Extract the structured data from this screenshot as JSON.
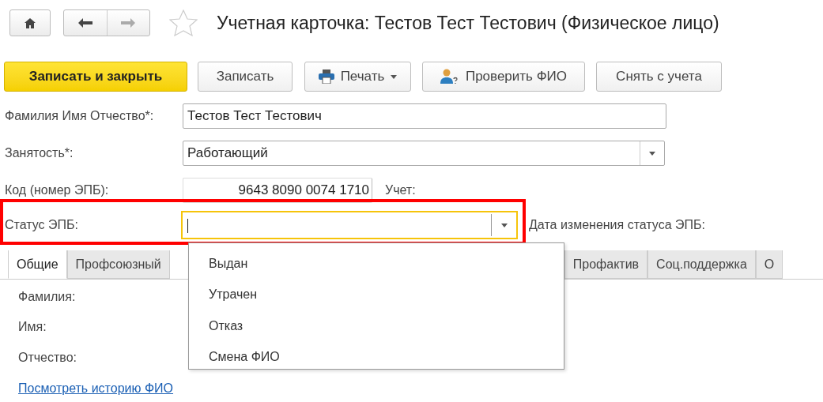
{
  "window": {
    "title": "Учетная карточка: Тестов Тест Тестович (Физическое лицо)",
    "favorite": false
  },
  "toolbar": [
    {
      "label": "Записать и закрыть",
      "kind": "primary"
    },
    {
      "label": "Записать",
      "kind": "plain"
    },
    {
      "label": "Печать",
      "kind": "menu"
    },
    {
      "label": "Проверить ФИО",
      "kind": "person"
    },
    {
      "label": "Снять с учета",
      "kind": "plain"
    }
  ],
  "fields": [
    {
      "label": "Фамилия Имя Отчество*:",
      "value": "Тестов Тест Тестович",
      "kind": "text"
    },
    {
      "label": "Занятость*:",
      "value": "Работающий",
      "kind": "select"
    },
    {
      "label": "Код (номер ЭПБ):",
      "value": "9643 8090 0074 1710",
      "kind": "code",
      "side_label": "Учет:"
    },
    {
      "label": "Статус ЭПБ:",
      "kind": "focused",
      "side_label": "Дата изменения статуса ЭПБ:",
      "highlighted": true
    }
  ],
  "tabs_left": [
    {
      "label": "Общие",
      "selected": true
    },
    {
      "label": "Профсоюзный",
      "selected": false
    }
  ],
  "tabs_right": [
    {
      "label": "Профактив",
      "selected": false
    },
    {
      "label": "Соц.поддержка",
      "selected": false
    },
    {
      "label": "О",
      "selected": false
    }
  ],
  "tab_content": {
    "labels": [
      "Фамилия:",
      "Имя:",
      "Отчество:"
    ],
    "link": "Посмотреть историю ФИО"
  },
  "dropdown": {
    "options": [
      "Выдан",
      "Утрачен",
      "Отказ",
      "Смена ФИО"
    ]
  }
}
